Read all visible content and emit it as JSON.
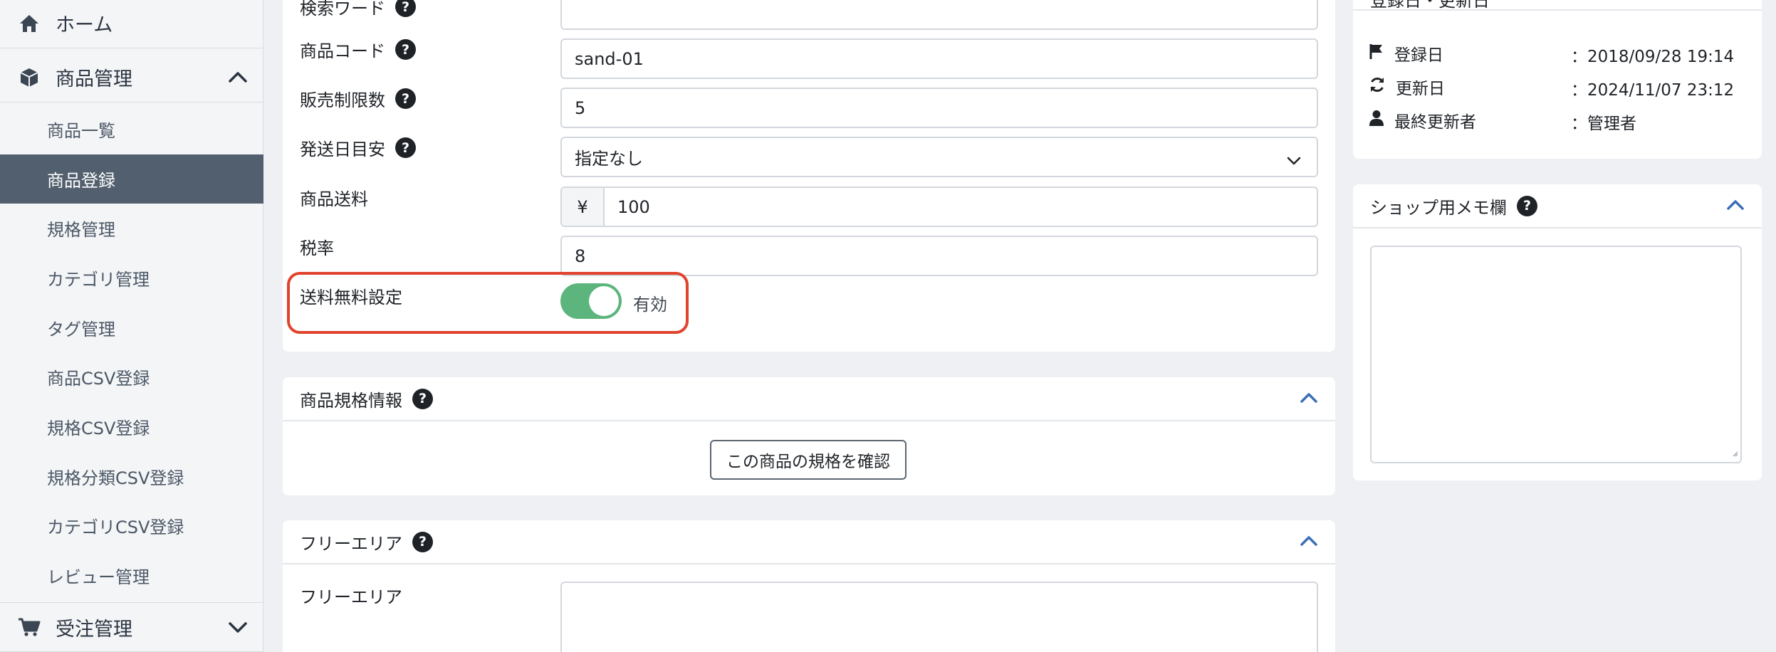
{
  "sidebar": {
    "home": "ホーム",
    "product_mgmt": "商品管理",
    "items": [
      "商品一覧",
      "商品登録",
      "規格管理",
      "カテゴリ管理",
      "タグ管理",
      "商品CSV登録",
      "規格CSV登録",
      "規格分類CSV登録",
      "カテゴリCSV登録",
      "レビュー管理"
    ],
    "order_mgmt": "受注管理",
    "active_index": 1
  },
  "form": {
    "search_word_label": "検索ワード",
    "product_code_label": "商品コード",
    "product_code_value": "sand-01",
    "sale_limit_label": "販売制限数",
    "sale_limit_value": "5",
    "delivery_label": "発送日目安",
    "delivery_value": "指定なし",
    "shipping_fee_label": "商品送料",
    "currency": "¥",
    "shipping_fee_value": "100",
    "tax_label": "税率",
    "tax_value": "8",
    "free_shipping_label": "送料無料設定",
    "free_shipping_state": "有効",
    "free_shipping_on": true
  },
  "spec_card": {
    "title": "商品規格情報",
    "button": "この商品の規格を確認"
  },
  "free_area_card": {
    "title": "フリーエリア",
    "field_label": "フリーエリア"
  },
  "dates_card": {
    "title": "登録日・更新日",
    "registered_label": "登録日",
    "registered_value": "：2018/09/28 19:14",
    "updated_label": "更新日",
    "updated_value": "：2024/11/07 23:12",
    "updater_label": "最終更新者",
    "updater_value": "：管理者"
  },
  "memo_card": {
    "title": "ショップ用メモ欄"
  },
  "colors": {
    "accent": "#3b6fb6",
    "toggle_on": "#5cb57c",
    "highlight": "#e0432e",
    "sidebar_active": "#525f6e"
  }
}
